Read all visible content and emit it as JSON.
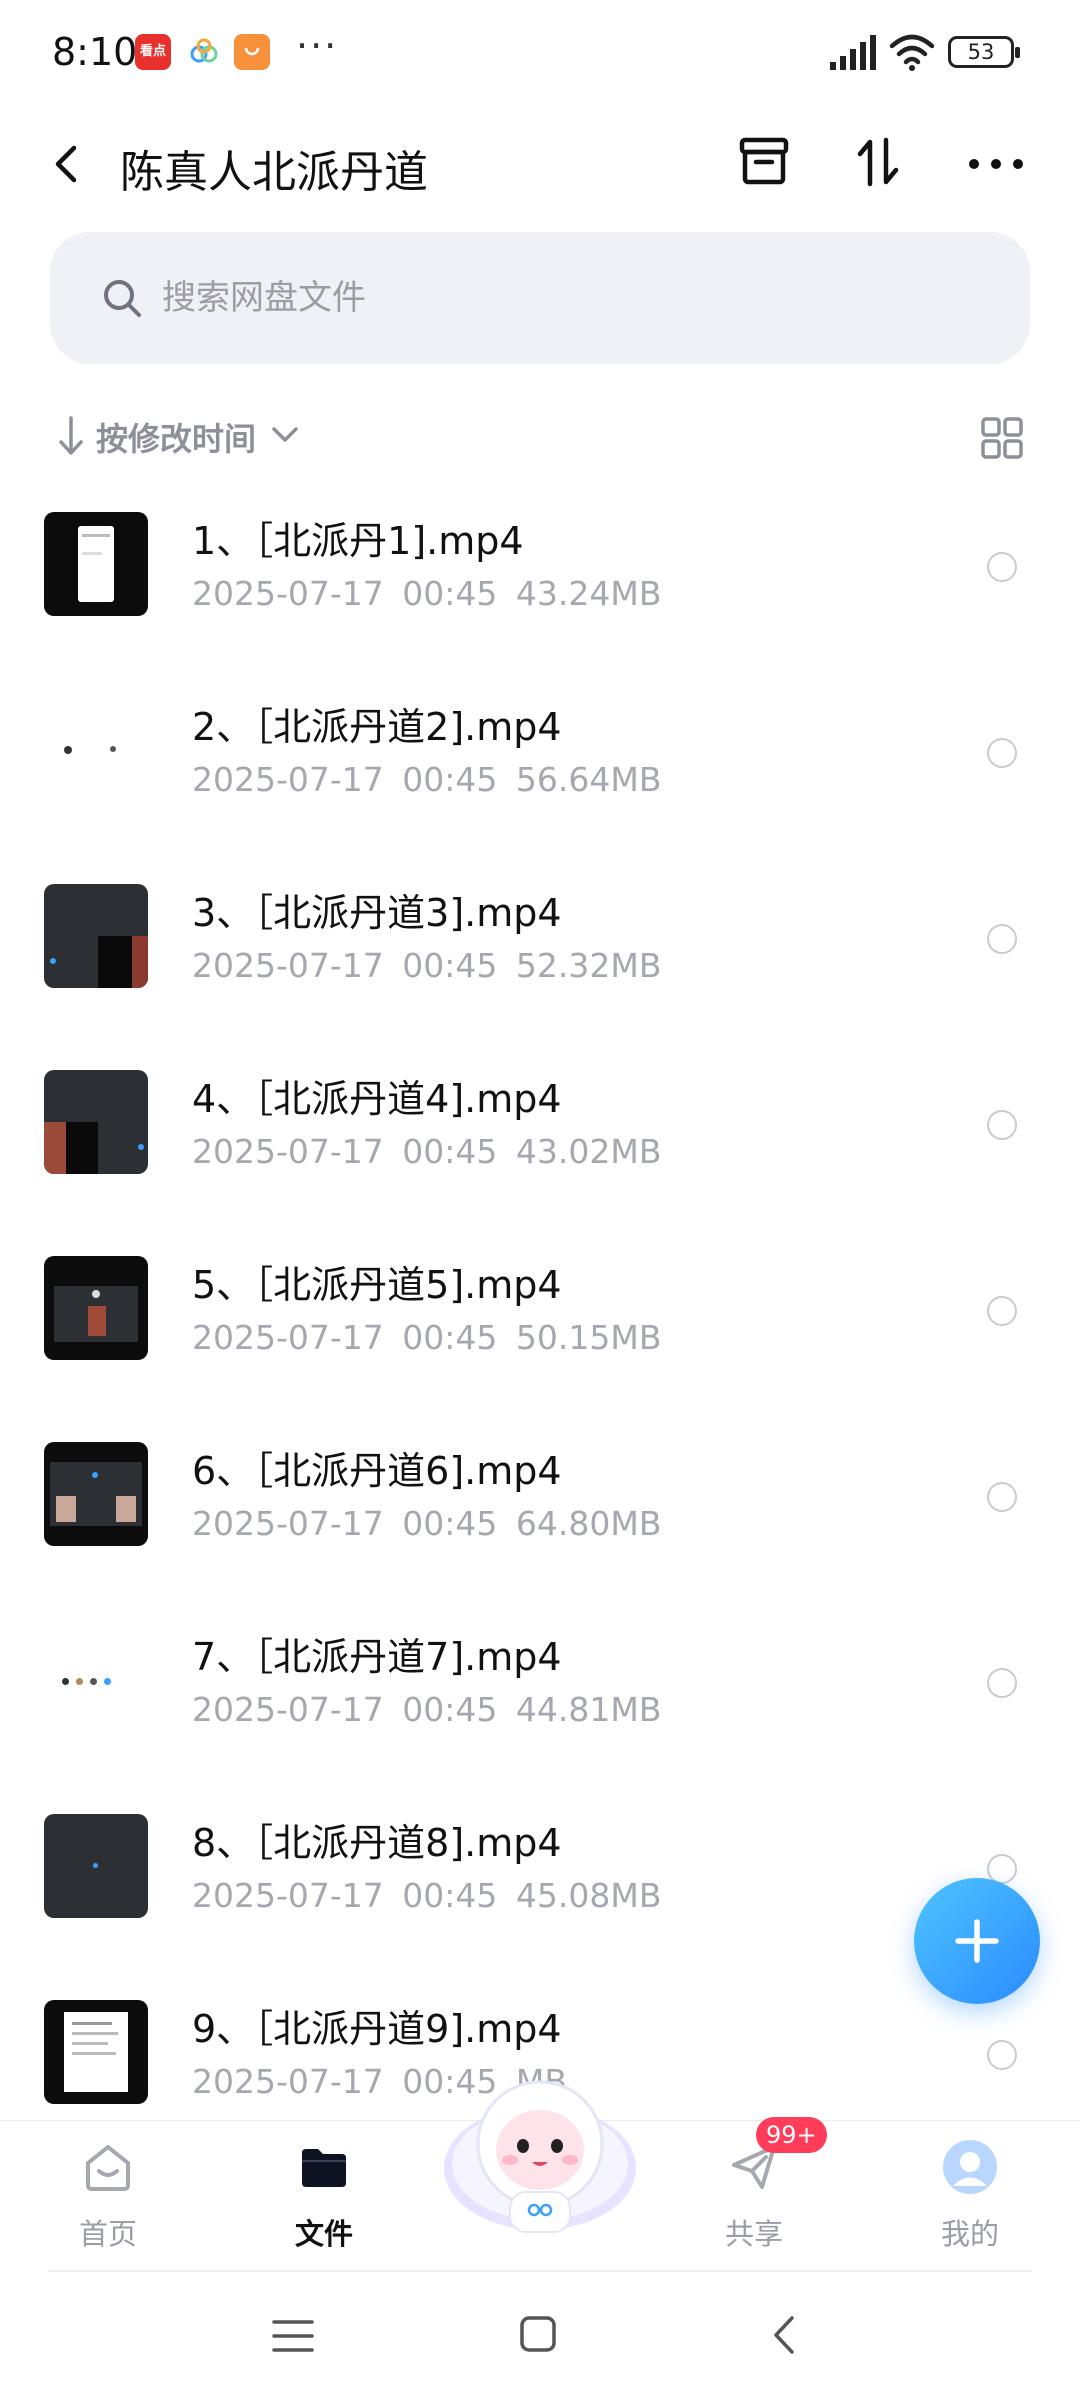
{
  "status_bar": {
    "time": "8:10",
    "notif_app_label": "看点",
    "more": "···",
    "battery": "53"
  },
  "header": {
    "title": "陈真人北派丹道"
  },
  "search": {
    "placeholder": "搜索网盘文件"
  },
  "sort": {
    "label": "按修改时间"
  },
  "files": [
    {
      "name": "1、［北派丹1].mp4",
      "date": "2025-07-17",
      "time": "00:45",
      "size": "43.24MB",
      "thumb": "dark-phone"
    },
    {
      "name": "2、［北派丹道2].mp4",
      "date": "2025-07-17",
      "time": "00:45",
      "size": "56.64MB",
      "thumb": "white-dots"
    },
    {
      "name": "3、［北派丹道3].mp4",
      "date": "2025-07-17",
      "time": "00:45",
      "size": "52.32MB",
      "thumb": "dark-video"
    },
    {
      "name": "4、［北派丹道4].mp4",
      "date": "2025-07-17",
      "time": "00:45",
      "size": "43.02MB",
      "thumb": "dark-video"
    },
    {
      "name": "5、［北派丹道5].mp4",
      "date": "2025-07-17",
      "time": "00:45",
      "size": "50.15MB",
      "thumb": "black-video"
    },
    {
      "name": "6、［北派丹道6].mp4",
      "date": "2025-07-17",
      "time": "00:45",
      "size": "64.80MB",
      "thumb": "black-video"
    },
    {
      "name": "7、［北派丹道7].mp4",
      "date": "2025-07-17",
      "time": "00:45",
      "size": "44.81MB",
      "thumb": "white-dots"
    },
    {
      "name": "8、［北派丹道8].mp4",
      "date": "2025-07-17",
      "time": "00:45",
      "size": "45.08MB",
      "thumb": "dark-plain"
    },
    {
      "name": "9、［北派丹道9].mp4",
      "date": "2025-07-17",
      "time": "00:45",
      "size": "MB",
      "thumb": "black-doc"
    }
  ],
  "bottom_nav": {
    "items": [
      {
        "label": "首页",
        "icon": "home-icon"
      },
      {
        "label": "文件",
        "icon": "folder-icon",
        "active": true
      },
      {
        "label": "共享",
        "icon": "share-icon",
        "badge": "99+"
      },
      {
        "label": "我的",
        "icon": "profile-icon"
      }
    ]
  },
  "colors": {
    "accent": "#2a8bff",
    "badge": "#ff3d5a",
    "muted_text": "#a6a8b0",
    "search_bg": "#f0f1f6"
  }
}
